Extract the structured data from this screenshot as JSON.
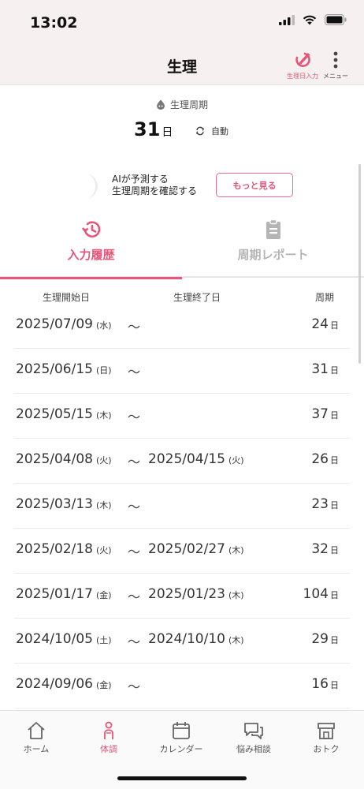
{
  "status_bar": {
    "time": "13:02"
  },
  "header": {
    "title": "生理",
    "period_input_label": "生理日入力",
    "menu_label": "メニュー"
  },
  "cycle": {
    "label": "生理周期",
    "value": "31",
    "unit": "日",
    "mode": "自動"
  },
  "ai_prediction": {
    "line1": "AIが予測する",
    "line2": "生理周期を確認する",
    "button": "もっと見る"
  },
  "tabs": [
    {
      "label": "入力履歴",
      "active": true,
      "icon": "history-icon"
    },
    {
      "label": "周期レポート",
      "active": false,
      "icon": "clipboard-icon"
    }
  ],
  "columns": {
    "start": "生理開始日",
    "end": "生理終了日",
    "cycle": "周期"
  },
  "history": [
    {
      "start": "2025/07/09",
      "start_dow": "(水)",
      "tilde": "〜",
      "end": "",
      "end_dow": "",
      "cycle": "24",
      "unit": "日"
    },
    {
      "start": "2025/06/15",
      "start_dow": "(日)",
      "tilde": "〜",
      "end": "",
      "end_dow": "",
      "cycle": "31",
      "unit": "日"
    },
    {
      "start": "2025/05/15",
      "start_dow": "(木)",
      "tilde": "〜",
      "end": "",
      "end_dow": "",
      "cycle": "37",
      "unit": "日"
    },
    {
      "start": "2025/04/08",
      "start_dow": "(火)",
      "tilde": "〜",
      "end": "2025/04/15",
      "end_dow": "(火)",
      "cycle": "26",
      "unit": "日"
    },
    {
      "start": "2025/03/13",
      "start_dow": "(木)",
      "tilde": "〜",
      "end": "",
      "end_dow": "",
      "cycle": "23",
      "unit": "日"
    },
    {
      "start": "2025/02/18",
      "start_dow": "(火)",
      "tilde": "〜",
      "end": "2025/02/27",
      "end_dow": "(木)",
      "cycle": "32",
      "unit": "日"
    },
    {
      "start": "2025/01/17",
      "start_dow": "(金)",
      "tilde": "〜",
      "end": "2025/01/23",
      "end_dow": "(木)",
      "cycle": "104",
      "unit": "日"
    },
    {
      "start": "2024/10/05",
      "start_dow": "(土)",
      "tilde": "〜",
      "end": "2024/10/10",
      "end_dow": "(木)",
      "cycle": "29",
      "unit": "日"
    },
    {
      "start": "2024/09/06",
      "start_dow": "(金)",
      "tilde": "〜",
      "end": "",
      "end_dow": "",
      "cycle": "16",
      "unit": "日"
    }
  ],
  "bottom_nav": [
    {
      "label": "ホーム",
      "icon": "home-icon",
      "active": false
    },
    {
      "label": "体調",
      "icon": "body-icon",
      "active": true
    },
    {
      "label": "カレンダー",
      "icon": "calendar-icon",
      "active": false
    },
    {
      "label": "悩み相談",
      "icon": "chat-icon",
      "active": false
    },
    {
      "label": "おトク",
      "icon": "shop-icon",
      "active": false
    }
  ],
  "colors": {
    "accent": "#e85578",
    "header_bg": "#f7f0f0"
  }
}
